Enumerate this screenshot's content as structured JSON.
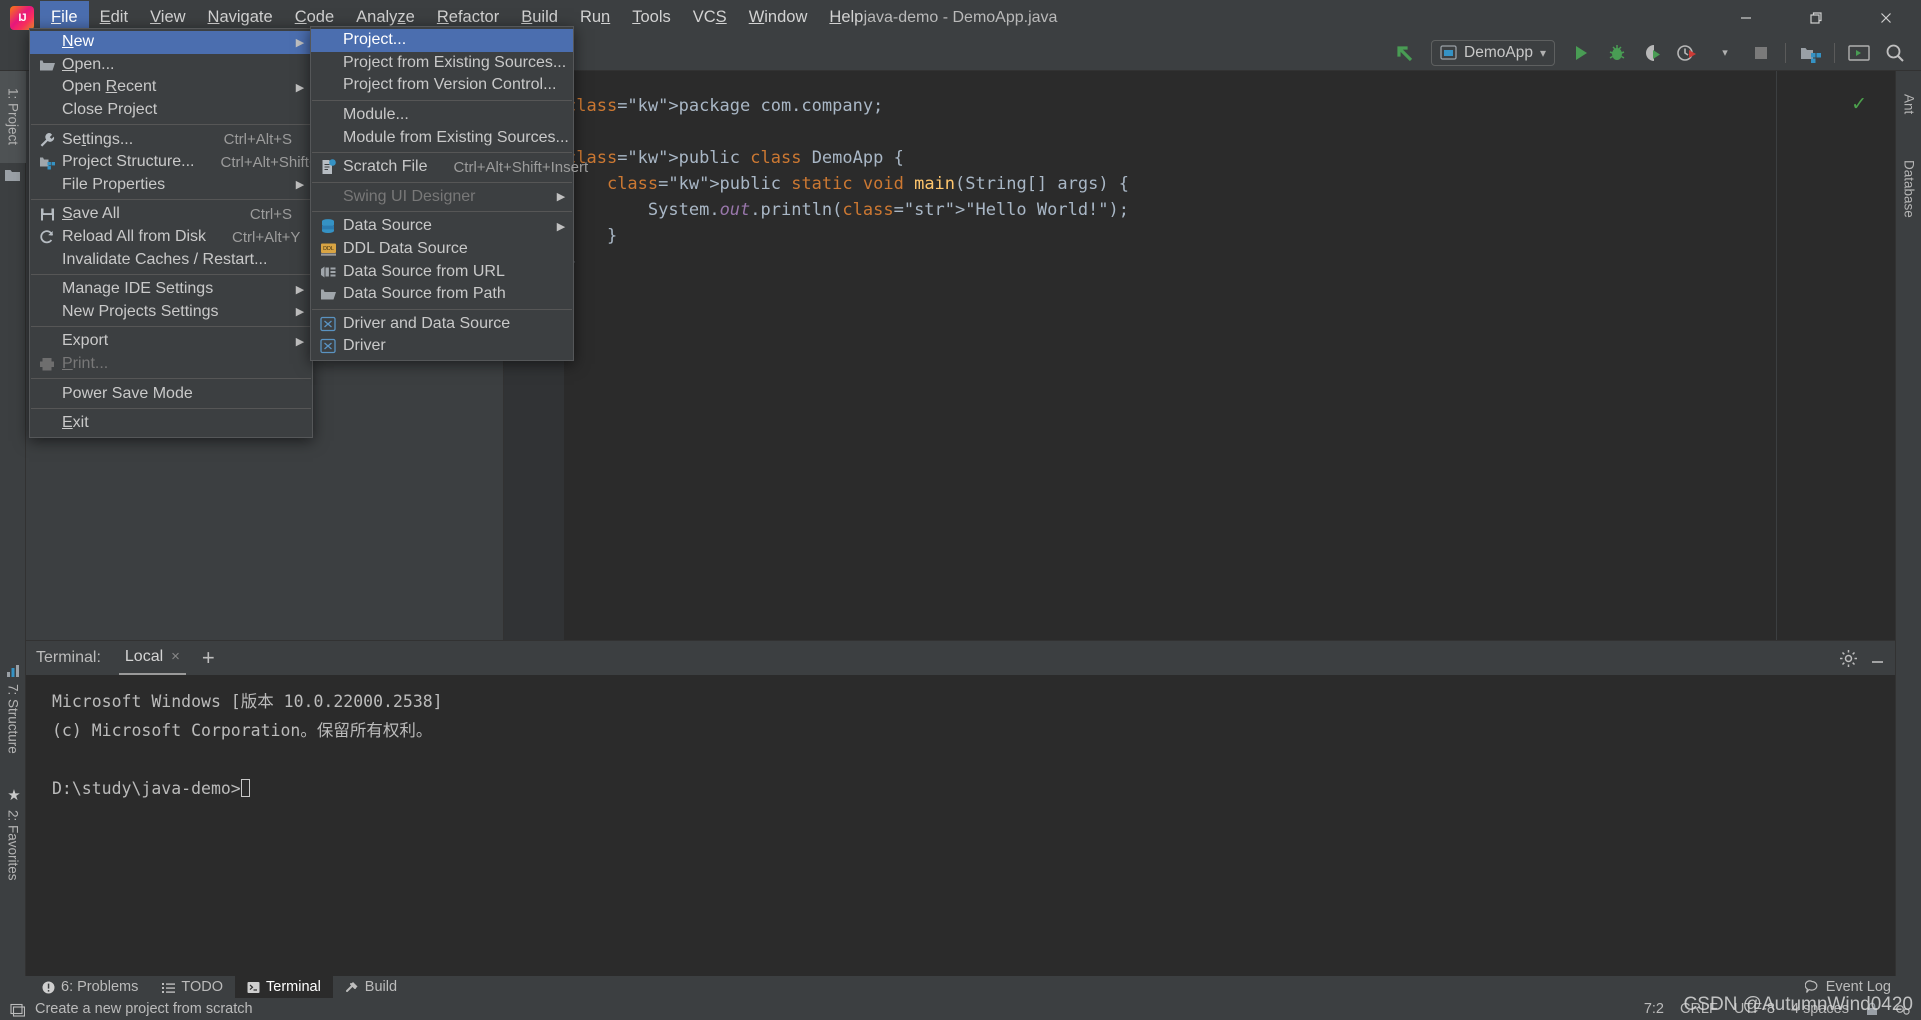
{
  "window": {
    "title": "java-demo - DemoApp.java",
    "minimize_label": "—",
    "restore_label": "❐",
    "close_label": "✕"
  },
  "menubar": {
    "items": [
      {
        "label": "File",
        "mnemonic": "F",
        "active": true
      },
      {
        "label": "Edit",
        "mnemonic": "E",
        "active": false
      },
      {
        "label": "View",
        "mnemonic": "V",
        "active": false
      },
      {
        "label": "Navigate",
        "mnemonic": "N",
        "active": false
      },
      {
        "label": "Code",
        "mnemonic": "C",
        "active": false
      },
      {
        "label": "Analyze",
        "mnemonic": "z",
        "active": false
      },
      {
        "label": "Refactor",
        "mnemonic": "R",
        "active": false
      },
      {
        "label": "Build",
        "mnemonic": "B",
        "active": false
      },
      {
        "label": "Run",
        "mnemonic": "n",
        "active": false
      },
      {
        "label": "Tools",
        "mnemonic": "T",
        "active": false
      },
      {
        "label": "VCS",
        "mnemonic": "S",
        "active": false
      },
      {
        "label": "Window",
        "mnemonic": "W",
        "active": false
      },
      {
        "label": "Help",
        "mnemonic": "H",
        "active": false
      }
    ]
  },
  "file_menu": {
    "items": [
      {
        "label": "New",
        "shortcut": "",
        "icon": "",
        "submenu": true,
        "highlight": true,
        "mnemonic": "N"
      },
      {
        "label": "Open...",
        "shortcut": "",
        "icon": "folder-open-icon",
        "submenu": false,
        "mnemonic": "O"
      },
      {
        "label": "Open Recent",
        "shortcut": "",
        "icon": "",
        "submenu": true,
        "mnemonic": "R"
      },
      {
        "label": "Close Project",
        "shortcut": "",
        "icon": "",
        "submenu": false
      },
      {
        "sep": true
      },
      {
        "label": "Settings...",
        "shortcut": "Ctrl+Alt+S",
        "icon": "wrench-icon",
        "submenu": false,
        "mnemonic": "t"
      },
      {
        "label": "Project Structure...",
        "shortcut": "Ctrl+Alt+Shift+S",
        "icon": "project-structure-icon",
        "submenu": false
      },
      {
        "label": "File Properties",
        "shortcut": "",
        "icon": "",
        "submenu": true
      },
      {
        "sep": true
      },
      {
        "label": "Save All",
        "shortcut": "Ctrl+S",
        "icon": "save-icon",
        "submenu": false,
        "mnemonic": "S"
      },
      {
        "label": "Reload All from Disk",
        "shortcut": "Ctrl+Alt+Y",
        "icon": "reload-icon",
        "submenu": false
      },
      {
        "label": "Invalidate Caches / Restart...",
        "shortcut": "",
        "icon": "",
        "submenu": false
      },
      {
        "sep": true
      },
      {
        "label": "Manage IDE Settings",
        "shortcut": "",
        "icon": "",
        "submenu": true
      },
      {
        "label": "New Projects Settings",
        "shortcut": "",
        "icon": "",
        "submenu": true
      },
      {
        "sep": true
      },
      {
        "label": "Export",
        "shortcut": "",
        "icon": "",
        "submenu": true
      },
      {
        "label": "Print...",
        "shortcut": "",
        "icon": "print-icon",
        "submenu": false,
        "disabled": true,
        "mnemonic": "P"
      },
      {
        "sep": true
      },
      {
        "label": "Power Save Mode",
        "shortcut": "",
        "icon": "",
        "submenu": false
      },
      {
        "sep": true
      },
      {
        "label": "Exit",
        "shortcut": "",
        "icon": "",
        "submenu": false,
        "mnemonic": "E"
      }
    ]
  },
  "new_submenu": {
    "items": [
      {
        "label": "Project...",
        "shortcut": "",
        "icon": "",
        "highlight": true
      },
      {
        "label": "Project from Existing Sources...",
        "shortcut": "",
        "icon": ""
      },
      {
        "label": "Project from Version Control...",
        "shortcut": "",
        "icon": ""
      },
      {
        "sep": true
      },
      {
        "label": "Module...",
        "shortcut": "",
        "icon": ""
      },
      {
        "label": "Module from Existing Sources...",
        "shortcut": "",
        "icon": ""
      },
      {
        "sep": true
      },
      {
        "label": "Scratch File",
        "shortcut": "Ctrl+Alt+Shift+Insert",
        "icon": "scratch-file-icon"
      },
      {
        "sep": true
      },
      {
        "label": "Swing UI Designer",
        "shortcut": "",
        "icon": "",
        "submenu": true,
        "disabled": true
      },
      {
        "sep": true
      },
      {
        "label": "Data Source",
        "shortcut": "",
        "icon": "database-icon",
        "submenu": true
      },
      {
        "label": "DDL Data Source",
        "shortcut": "",
        "icon": "ddl-icon"
      },
      {
        "label": "Data Source from URL",
        "shortcut": "",
        "icon": "data-source-url-icon"
      },
      {
        "label": "Data Source from Path",
        "shortcut": "",
        "icon": "folder-open-icon"
      },
      {
        "sep": true
      },
      {
        "label": "Driver and Data Source",
        "shortcut": "",
        "icon": "driver-icon"
      },
      {
        "label": "Driver",
        "shortcut": "",
        "icon": "driver-icon"
      }
    ]
  },
  "toolbar": {
    "vcs_update_icon": "vcs-update-arrow-icon",
    "run_config": {
      "label": "DemoApp",
      "icon": "run-config-icon",
      "caret": "▾"
    },
    "run_label": "▶",
    "debug_label": "debug-icon",
    "coverage_label": "coverage-icon",
    "profiler_label": "profiler-icon",
    "stop_label": "stop-icon",
    "project_structure_label": "project-structure-icon",
    "terminal_label": "terminal-icon",
    "search_label": "search-icon"
  },
  "left_tools": [
    {
      "label": "1: Project",
      "mnemonic": "1",
      "selected": true
    },
    {
      "label": "7: Structure",
      "mnemonic": "7",
      "selected": false
    },
    {
      "label": "2: Favorites",
      "mnemonic": "2",
      "selected": false
    }
  ],
  "right_tools": [
    {
      "label": "Ant",
      "selected": false
    },
    {
      "label": "Database",
      "selected": false
    }
  ],
  "editor": {
    "code_lines": [
      "package com.company;",
      "",
      "public class DemoApp {",
      "    public static void main(String[] args) {",
      "        System.out.println(\"Hello World!\");",
      "    }",
      "}"
    ],
    "inspection_status": "✓"
  },
  "terminal": {
    "label": "Terminal:",
    "tab_name": "Local",
    "tab_close": "×",
    "add_tab": "+",
    "settings_icon": "gear-icon",
    "minimize_icon": "minimize-icon",
    "lines": [
      "Microsoft Windows [版本 10.0.22000.2538]",
      "(c) Microsoft Corporation。保留所有权利。",
      "",
      "D:\\study\\java-demo>"
    ]
  },
  "bottom_tools": [
    {
      "label": "6: Problems",
      "mnemonic": "6",
      "icon": "problems-icon",
      "selected": false
    },
    {
      "label": "TODO",
      "icon": "todo-icon",
      "selected": false
    },
    {
      "label": "Terminal",
      "icon": "terminal-icon",
      "selected": true
    },
    {
      "label": "Build",
      "icon": "build-hammer-icon",
      "selected": false
    }
  ],
  "statusbar": {
    "hint": "Create a new project from scratch",
    "hint_icon": "tip-icon",
    "event_log": "Event Log",
    "event_log_icon": "event-log-icon",
    "caret_position": "7:2",
    "line_separator": "CRLF",
    "encoding": "UTF-8",
    "indent": "4 spaces",
    "lock_icon": "lock-icon",
    "inspections_icon": "inspections-icon",
    "watermark": "CSDN @AutumnWind0420"
  },
  "colors": {
    "bg": "#3c3f41",
    "editor_bg": "#2b2b2b",
    "accent": "#4b6eaf",
    "text": "#bbbbbb",
    "green": "#499c54"
  }
}
